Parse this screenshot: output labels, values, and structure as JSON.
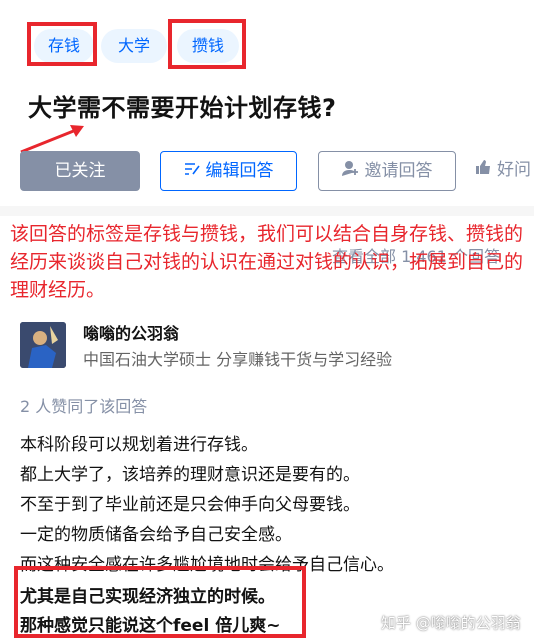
{
  "tags": [
    "存钱",
    "大学",
    "攒钱"
  ],
  "question_title": "大学需不需要开始计划存钱?",
  "buttons": {
    "follow": "已关注",
    "edit": "编辑回答",
    "invite": "邀请回答",
    "good": "好问"
  },
  "view_all": "查看全部 1,461 个回答",
  "annotation": "该回答的标签是存钱与攒钱，我们可以结合自身存钱、攒钱的经历来谈谈自己对钱的认识在通过对钱的认识，拓展到自己的理财经历。",
  "author": {
    "name": "嗡嗡的公羽翁",
    "bio": "中国石油大学硕士 分享赚钱干货与学习经验"
  },
  "votes": "2 人赞同了该回答",
  "paragraphs": [
    "本科阶段可以规划着进行存钱。",
    "都上大学了，该培养的理财意识还是要有的。",
    "不至于到了毕业前还是只会伸手向父母要钱。",
    "一定的物质储备会给予自己安全感。",
    "而这种安全感在许多尴尬境地时会给予自己信心。"
  ],
  "bold_lines": [
    "尤其是自己实现经济独立的时候。",
    "那种感觉只能说这个feel 倍儿爽~"
  ],
  "watermark": "知乎 @嗡嗡的公羽翁",
  "colors": {
    "accent": "#0066ff",
    "annotation_red": "#e8262d",
    "muted": "#8590a6"
  }
}
